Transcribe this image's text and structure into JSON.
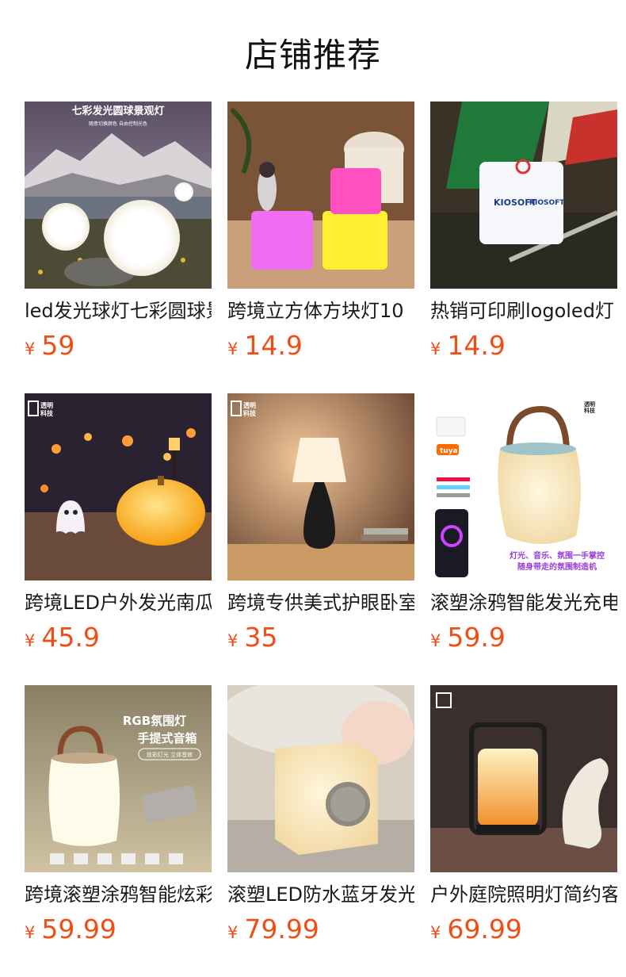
{
  "page": {
    "title": "店铺推荐"
  },
  "products": [
    {
      "name": "led发光球灯七彩圆球景观灯",
      "currency": "¥",
      "price": "59",
      "image_text": [
        "七彩发光圆球景观灯",
        "随意切换颜色 自由控制光色"
      ]
    },
    {
      "name": "跨境立方体方块灯10",
      "currency": "¥",
      "price": "14.9",
      "image_text": []
    },
    {
      "name": "热销可印刷logoled灯",
      "currency": "¥",
      "price": "14.9",
      "image_text": [
        "KIOSOFT",
        "KIOSOFT"
      ]
    },
    {
      "name": "跨境LED户外发光南瓜",
      "currency": "¥",
      "price": "45.9",
      "image_text": [
        "透明",
        "科技"
      ]
    },
    {
      "name": "跨境专供美式护眼卧室",
      "currency": "¥",
      "price": "35",
      "image_text": [
        "透明",
        "科技"
      ]
    },
    {
      "name": "滚塑涂鸦智能发光充电",
      "currency": "¥",
      "price": "59.9",
      "image_text": [
        "透明",
        "科技",
        "tuya",
        "灯光、音乐、氛围一手掌控",
        "随身带走的氛围制造机"
      ]
    },
    {
      "name": "跨境滚塑涂鸦智能炫彩",
      "currency": "¥",
      "price": "59.99",
      "image_text": [
        "RGB氛围灯",
        "手提式音箱",
        "炫彩灯光 立体音效"
      ]
    },
    {
      "name": "滚塑LED防水蓝牙发光",
      "currency": "¥",
      "price": "79.99",
      "image_text": []
    },
    {
      "name": "户外庭院照明灯简约客厅",
      "currency": "¥",
      "price": "69.99",
      "image_text": []
    }
  ]
}
